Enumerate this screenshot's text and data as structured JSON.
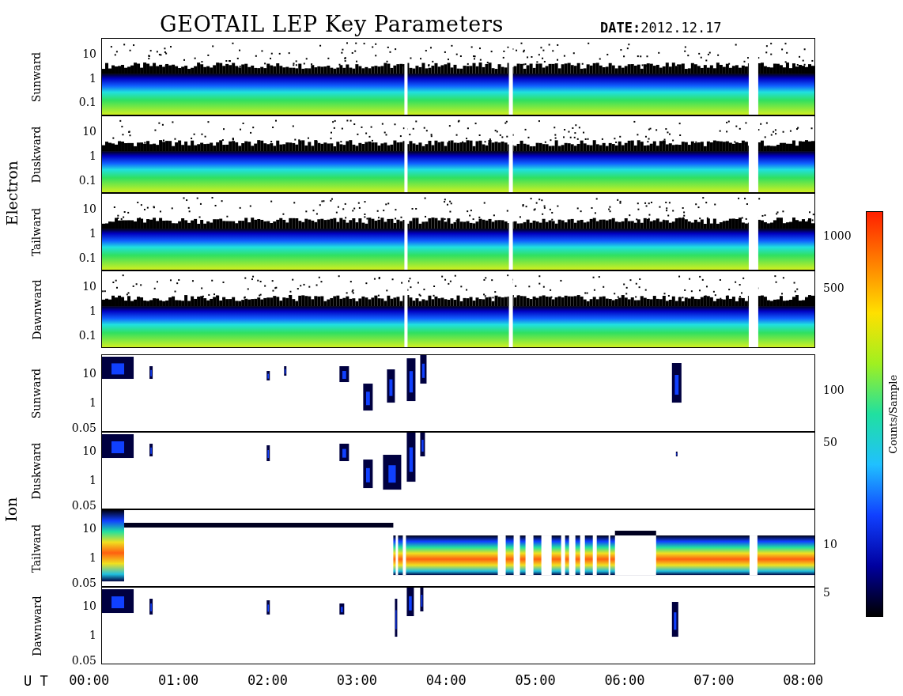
{
  "title": "GEOTAIL LEP Key Parameters",
  "date": {
    "label": "DATE:",
    "value": "2012.12.17"
  },
  "groups": [
    {
      "label": "Electron",
      "panels": [
        {
          "label": "Sunward",
          "kind": "electron",
          "yticks": [
            "10",
            "1",
            "0.1"
          ]
        },
        {
          "label": "Duskward",
          "kind": "electron",
          "yticks": [
            "10",
            "1",
            "0.1"
          ]
        },
        {
          "label": "Tailward",
          "kind": "electron",
          "yticks": [
            "10",
            "1",
            "0.1"
          ]
        },
        {
          "label": "Dawnward",
          "kind": "electron",
          "yticks": [
            "10",
            "1",
            "0.1"
          ]
        }
      ]
    },
    {
      "label": "Ion",
      "panels": [
        {
          "label": "Sunward",
          "kind": "ion-sparse",
          "yticks": [
            "10",
            "1",
            "0.05"
          ]
        },
        {
          "label": "Duskward",
          "kind": "ion-sparse",
          "yticks": [
            "10",
            "1",
            "0.05"
          ]
        },
        {
          "label": "Tailward",
          "kind": "ion-band",
          "yticks": [
            "10",
            "1",
            "0.05"
          ]
        },
        {
          "label": "Dawnward",
          "kind": "ion-sparse",
          "yticks": [
            "10",
            "1",
            "0.05"
          ]
        }
      ]
    }
  ],
  "colorbar": {
    "label": "Counts/Sample",
    "ticks": [
      "1000",
      "500",
      "100",
      "50",
      "10",
      "5"
    ]
  },
  "x_axis": {
    "label": "U T",
    "ticks": [
      "00:00",
      "01:00",
      "02:00",
      "03:00",
      "04:00",
      "05:00",
      "06:00",
      "07:00",
      "08:00"
    ]
  }
}
